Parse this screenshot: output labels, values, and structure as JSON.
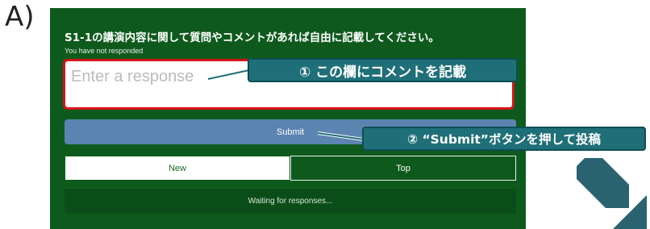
{
  "section_label": "A)",
  "form": {
    "question": "S1-1の講演内容に関して質問やコメントがあれば自由に記載してください。",
    "status": "You have not responded",
    "response_placeholder": "Enter a response",
    "submit_label": "Submit",
    "tabs": [
      {
        "label": "New",
        "selected": true
      },
      {
        "label": "Top",
        "selected": false
      }
    ],
    "waiting_text": "Waiting for responses..."
  },
  "annotations": {
    "callout_1": "① この欄にコメントを記載",
    "callout_2": "② “Submit”ボタンを押して投稿"
  },
  "colors": {
    "panel": "#0e5a1d",
    "submit": "#5c84b1",
    "callout": "#1f6f78",
    "highlight_border": "#d6141b",
    "arrow": "#2a6270"
  }
}
